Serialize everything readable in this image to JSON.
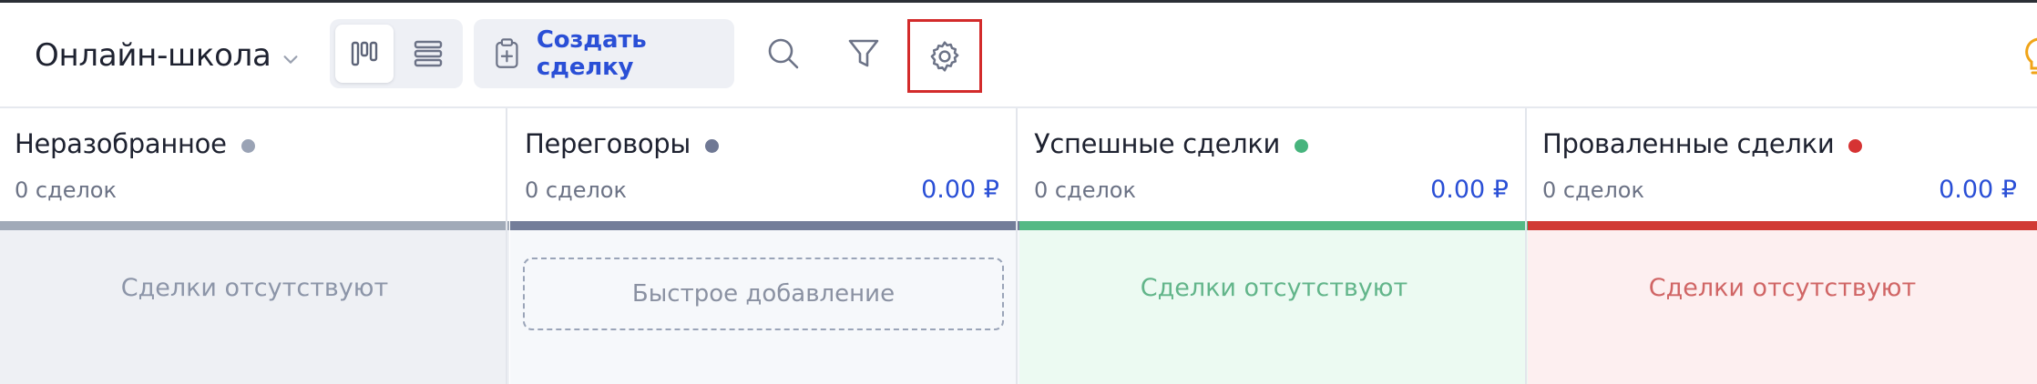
{
  "toolbar": {
    "pipeline_name": "Онлайн-школа",
    "create_deal_label": "Создать сделку"
  },
  "columns": [
    {
      "title": "Неразобранное",
      "count": "0 сделок",
      "sum": "",
      "dot_color": "#9aa3b5",
      "bar_color": "#a1aab8",
      "body_bg": "#eef0f4",
      "empty_text": "Сделки отсутствуют",
      "empty_color": "#8c95a8"
    },
    {
      "title": "Переговоры",
      "count": "0 сделок",
      "sum": "0.00 ₽",
      "dot_color": "#6f7894",
      "bar_color": "#737d99",
      "body_bg": "#f6f8fb",
      "quick_add": "Быстрое добавление"
    },
    {
      "title": "Успешные сделки",
      "count": "0 сделок",
      "sum": "0.00 ₽",
      "dot_color": "#47b47d",
      "bar_color": "#55b985",
      "body_bg": "#ecfaf2",
      "empty_text": "Сделки отсутствуют",
      "empty_color": "#62b58a"
    },
    {
      "title": "Проваленные сделки",
      "count": "0 сделок",
      "sum": "0.00 ₽",
      "dot_color": "#d63333",
      "bar_color": "#d13a35",
      "body_bg": "#fdeff0",
      "empty_text": "Сделки отсутствуют",
      "empty_color": "#d06565"
    }
  ]
}
